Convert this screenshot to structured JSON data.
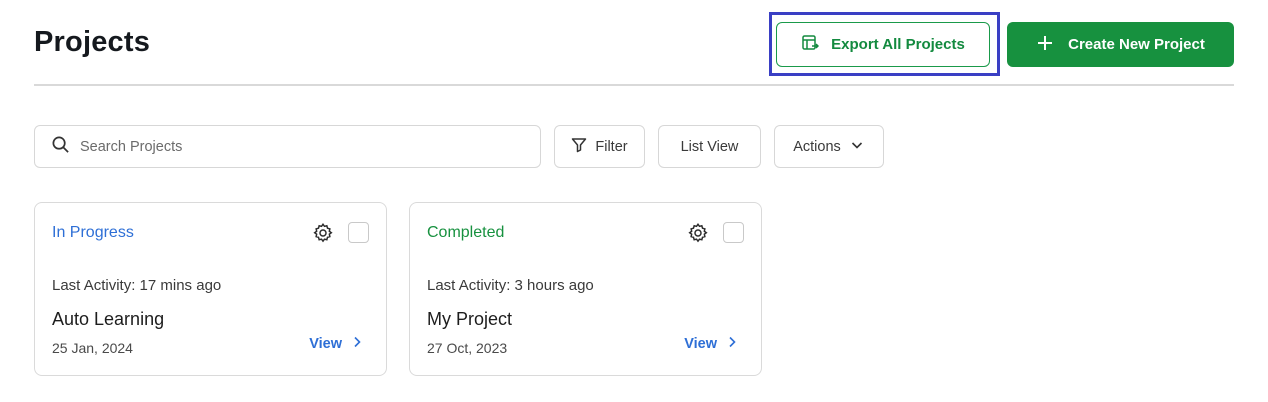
{
  "header": {
    "title": "Projects",
    "export_label": "Export All Projects",
    "create_label": "Create New Project"
  },
  "toolbar": {
    "search_placeholder": "Search Projects",
    "filter_label": "Filter",
    "list_view_label": "List View",
    "actions_label": "Actions"
  },
  "projects": [
    {
      "status": "In Progress",
      "status_color": "#2e6fd6",
      "activity": "Last Activity: 17 mins ago",
      "name": "Auto Learning",
      "date": "25 Jan, 2024",
      "view_label": "View"
    },
    {
      "status": "Completed",
      "status_color": "#17913f",
      "activity": "Last Activity: 3 hours ago",
      "name": "My Project",
      "date": "27 Oct, 2023",
      "view_label": "View"
    }
  ],
  "icons": {
    "export": "table-export-icon",
    "create": "plus-icon",
    "search": "search-icon",
    "filter": "filter-icon",
    "actions": "chevron-down-icon",
    "settings": "gear-icon",
    "view": "chevron-right-icon"
  },
  "colors": {
    "primary_green": "#17913f",
    "link_blue": "#2e6fd6",
    "highlight": "#3a3fc4"
  }
}
